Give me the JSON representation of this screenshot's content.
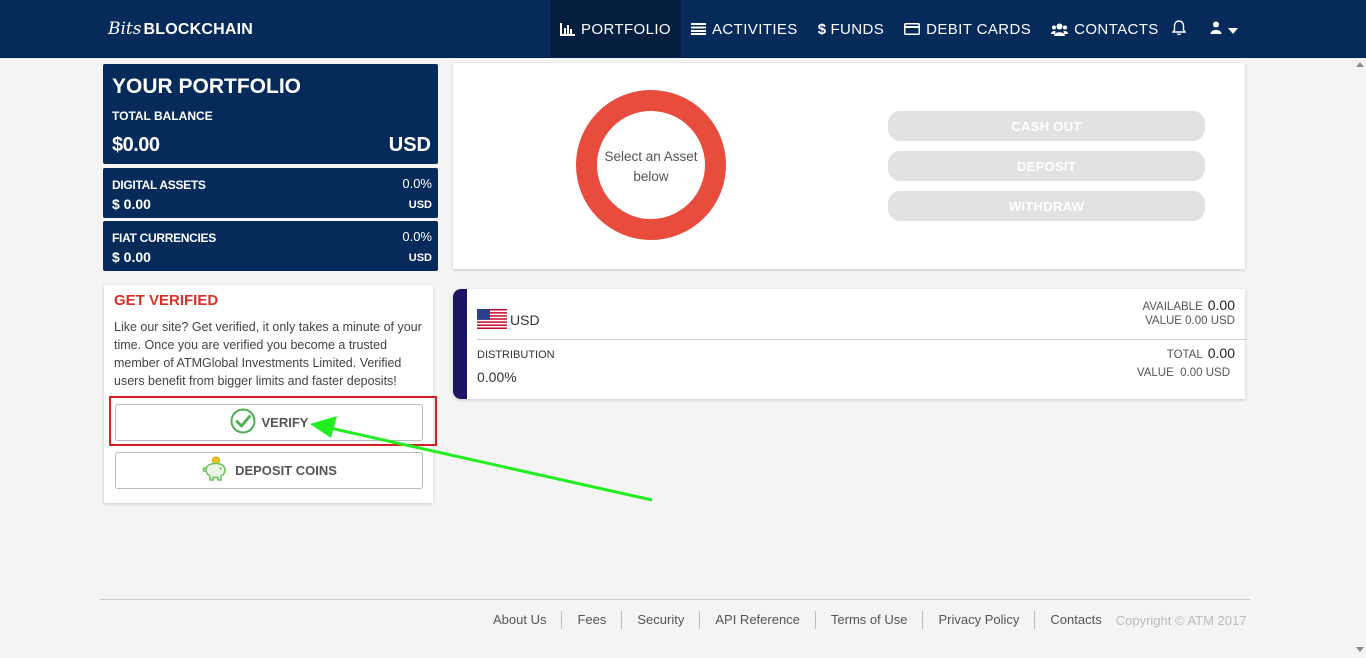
{
  "brand": {
    "script": "Bits",
    "name": "BLOCKCHAIN"
  },
  "nav": {
    "items": [
      {
        "label": "PORTFOLIO",
        "icon": "bar-chart-icon"
      },
      {
        "label": "ACTIVITIES",
        "icon": "list-icon"
      },
      {
        "label": "FUNDS",
        "icon": "dollar-icon"
      },
      {
        "label": "DEBIT CARDS",
        "icon": "credit-card-icon"
      },
      {
        "label": "CONTACTS",
        "icon": "users-icon"
      }
    ],
    "active": "PORTFOLIO",
    "bell_icon": "bell-icon",
    "user_icon": "user-icon"
  },
  "portfolio": {
    "title": "YOUR PORTFOLIO",
    "total_label": "TOTAL BALANCE",
    "total_amount": "$0.00",
    "total_currency": "USD",
    "digital": {
      "label": "DIGITAL ASSETS",
      "value": "$ 0.00",
      "percent": "0.0%",
      "currency": "USD"
    },
    "fiat": {
      "label": "FIAT CURRENCIES",
      "value": "$ 0.00",
      "percent": "0.0%",
      "currency": "USD"
    }
  },
  "verify": {
    "title": "GET VERIFIED",
    "text": "Like our site? Get verified, it only takes a minute of your time. Once you are verified you become a trusted member of ATMGlobal Investments Limited. Verified users benefit from bigger limits and faster deposits!",
    "verify_button": "VERIFY",
    "deposit_button": "DEPOSIT COINS"
  },
  "donut": {
    "center_text": "Select an Asset below",
    "ring_color": "#e74c3c"
  },
  "actions": {
    "cash_out": "CASH OUT",
    "deposit": "DEPOSIT",
    "withdraw": "WITHDRAW"
  },
  "asset": {
    "name": "USD",
    "available_label": "AVAILABLE",
    "available_value": "0.00",
    "value_label": "VALUE 0.00 USD",
    "distribution_label": "DISTRIBUTION",
    "distribution_value": "0.00%",
    "total_label": "TOTAL",
    "total_value": "0.00",
    "total_value_label": "VALUE  0.00 USD"
  },
  "footer": {
    "links": [
      "About Us",
      "Fees",
      "Security",
      "API Reference",
      "Terms of Use",
      "Privacy Policy",
      "Contacts"
    ],
    "copyright": "Copyright © ATM 2017"
  },
  "colors": {
    "navy": "#062a5a",
    "accent_red": "#d9302a",
    "annotation_green": "#22ee22",
    "asset_border": "#1c1461"
  }
}
